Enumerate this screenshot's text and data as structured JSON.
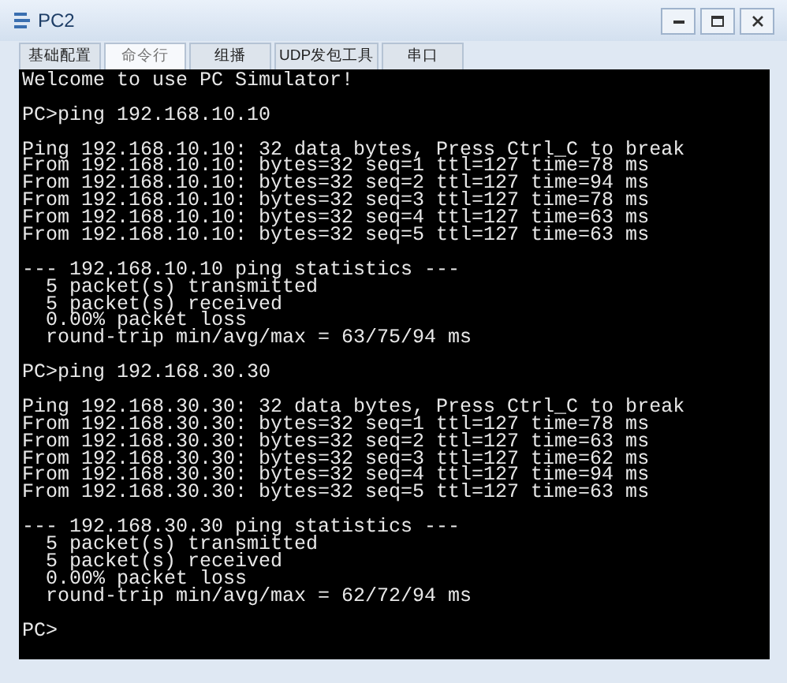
{
  "window": {
    "title": "PC2"
  },
  "tabs": [
    {
      "label": "基础配置",
      "selected": false
    },
    {
      "label": "命令行",
      "selected": true
    },
    {
      "label": "组播",
      "selected": false
    },
    {
      "label": "UDP发包工具",
      "selected": false
    },
    {
      "label": "串口",
      "selected": false
    }
  ],
  "terminal": {
    "blocks": [
      [
        "Welcome to use PC Simulator!"
      ],
      [
        "PC>ping 192.168.10.10"
      ],
      [
        "Ping 192.168.10.10: 32 data bytes, Press Ctrl_C to break",
        "From 192.168.10.10: bytes=32 seq=1 ttl=127 time=78 ms",
        "From 192.168.10.10: bytes=32 seq=2 ttl=127 time=94 ms",
        "From 192.168.10.10: bytes=32 seq=3 ttl=127 time=78 ms",
        "From 192.168.10.10: bytes=32 seq=4 ttl=127 time=63 ms",
        "From 192.168.10.10: bytes=32 seq=5 ttl=127 time=63 ms"
      ],
      [
        "--- 192.168.10.10 ping statistics ---",
        "  5 packet(s) transmitted",
        "  5 packet(s) received",
        "  0.00% packet loss",
        "  round-trip min/avg/max = 63/75/94 ms"
      ],
      [
        "PC>ping 192.168.30.30"
      ],
      [
        "Ping 192.168.30.30: 32 data bytes, Press Ctrl_C to break",
        "From 192.168.30.30: bytes=32 seq=1 ttl=127 time=78 ms",
        "From 192.168.30.30: bytes=32 seq=2 ttl=127 time=63 ms",
        "From 192.168.30.30: bytes=32 seq=3 ttl=127 time=62 ms",
        "From 192.168.30.30: bytes=32 seq=4 ttl=127 time=94 ms",
        "From 192.168.30.30: bytes=32 seq=5 ttl=127 time=63 ms"
      ],
      [
        "--- 192.168.30.30 ping statistics ---",
        "  5 packet(s) transmitted",
        "  5 packet(s) received",
        "  0.00% packet loss",
        "  round-trip min/avg/max = 62/72/94 ms"
      ],
      [
        "PC>"
      ]
    ]
  }
}
